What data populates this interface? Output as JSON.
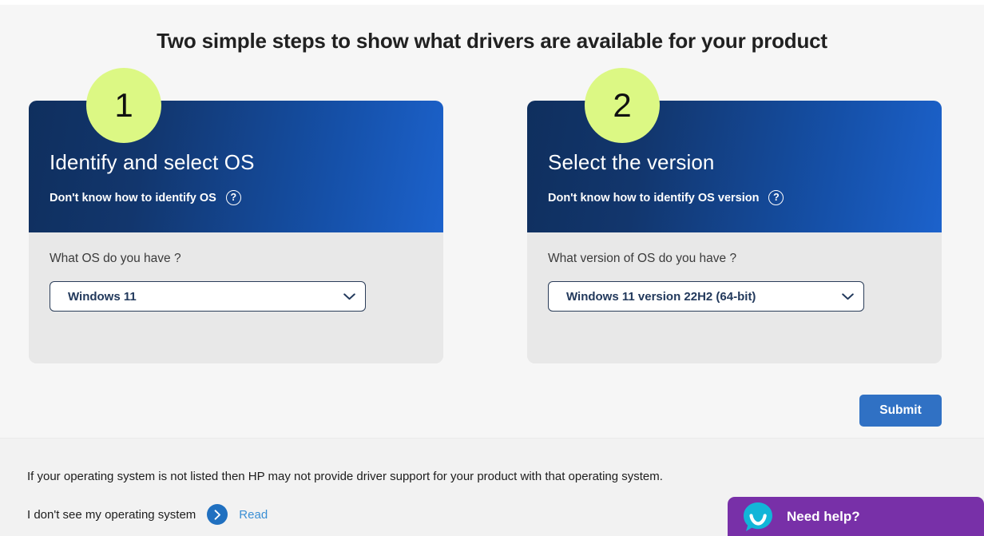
{
  "page": {
    "title": "Two simple steps to show what drivers are available for your product"
  },
  "steps": [
    {
      "badge": "1",
      "title": "Identify and select OS",
      "subtitle": "Don't know how to identify OS",
      "help_icon": "question-mark-icon",
      "field_label": "What OS do you have ?",
      "select_value": "Windows 11",
      "select_icon": "chevron-down-icon"
    },
    {
      "badge": "2",
      "title": "Select the version",
      "subtitle": "Don't know how to identify OS version",
      "help_icon": "question-mark-icon",
      "field_label": "What version of OS do you have ?",
      "select_value": "Windows 11 version 22H2 (64-bit)",
      "select_icon": "chevron-down-icon"
    }
  ],
  "actions": {
    "submit_label": "Submit"
  },
  "footer": {
    "note": "If your operating system is not listed then HP may not provide driver support for your product with that operating system.",
    "row_label": "I don't see my operating system",
    "chevron_icon": "chevron-right-circle-icon",
    "read_link": "Read"
  },
  "chat": {
    "avatar_icon": "chat-bubble-smile-icon",
    "label": "Need help?"
  },
  "colors": {
    "badge": "#dcf884",
    "header_dark": "#0f2f5e",
    "header_light": "#1c62cc",
    "submit": "#3071c4",
    "link": "#3b8fd4",
    "chat_panel": "#7830a8",
    "chat_avatar": "#12b5d8",
    "card_body": "#e8e8e8",
    "page_bg": "#f6f6f6"
  }
}
